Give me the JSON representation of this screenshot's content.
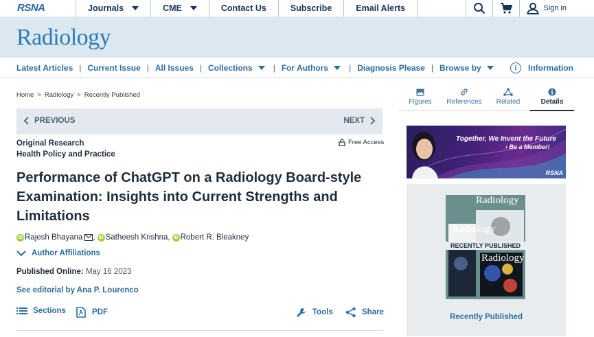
{
  "header": {
    "logo_text": "RSNA",
    "nav": [
      "Journals",
      "CME",
      "Contact Us",
      "Subscribe",
      "Email Alerts"
    ],
    "sign_in": "Sign in",
    "journal_title": "Radiology"
  },
  "subnav": {
    "items": [
      "Latest Articles",
      "Current Issue",
      "All Issues",
      "Collections",
      "For Authors",
      "Diagnosis Please",
      "Browse by"
    ],
    "info_label": "Information"
  },
  "breadcrumb": [
    "Home",
    "Radiology",
    "Recently Published"
  ],
  "pager": {
    "prev": "PREVIOUS",
    "next": "NEXT"
  },
  "article": {
    "type": "Original Research",
    "subtype": "Health Policy and Practice",
    "access": "Free Access",
    "title": "Performance of ChatGPT on a Radiology Board-style Examination: Insights into Current Strengths and Limitations",
    "authors": [
      "Rajesh Bhayana",
      "Satheesh Krishna",
      "Robert R. Bleakney"
    ],
    "author_affiliations_label": "Author Affiliations",
    "published_label": "Published Online:",
    "published_date": "May 16 2023",
    "editorial": "See editorial by Ana P. Lourenco",
    "actions": {
      "sections": "Sections",
      "pdf": "PDF",
      "tools": "Tools",
      "share": "Share"
    }
  },
  "side_tabs": [
    "Figures",
    "References",
    "Related",
    "Details"
  ],
  "ad": {
    "line1": "Together, We Invent the Future",
    "line2": "› Be a Member!",
    "logo": "RSNA"
  },
  "promo": {
    "cover_title": "Radiology",
    "strip": "RECENTLY PUBLISHED",
    "label": "Recently Published"
  },
  "colors": {
    "link": "#2a6d9e",
    "band": "#dbe8ef",
    "brand": "#2e7bb3"
  }
}
